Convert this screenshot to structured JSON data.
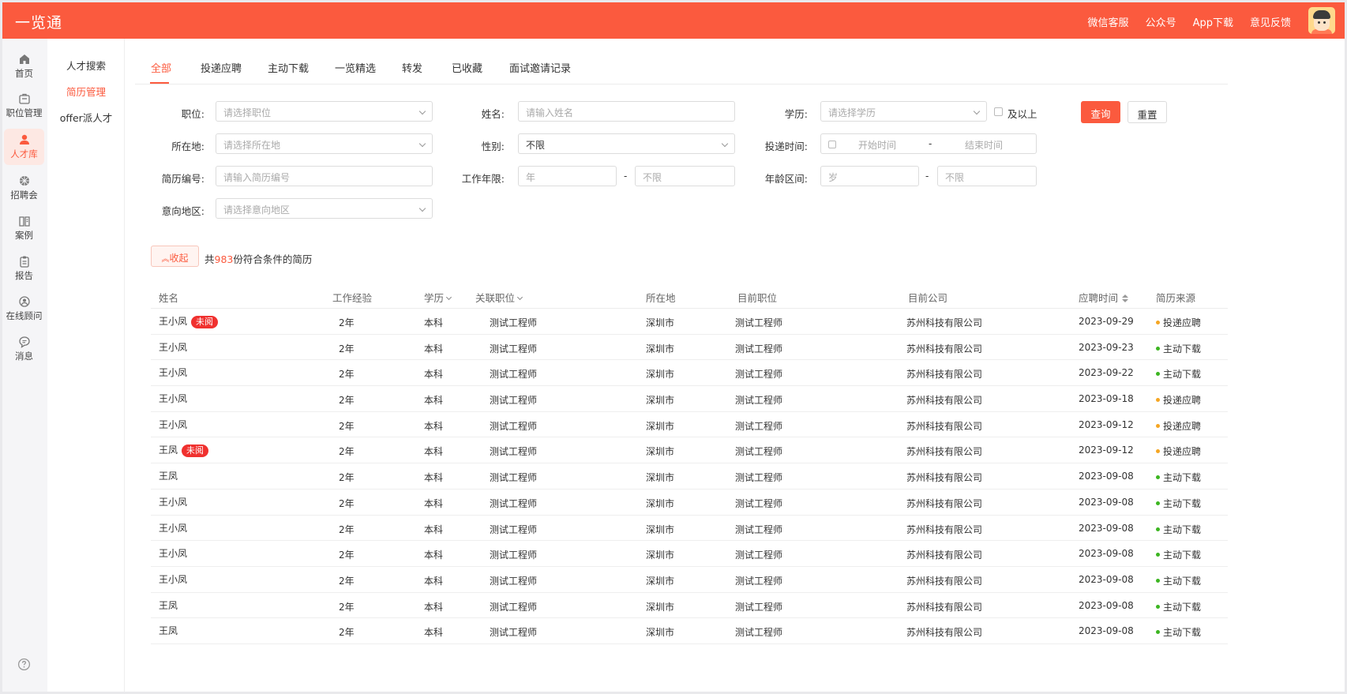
{
  "app": {
    "title": "一览通"
  },
  "top_links": [
    "微信客服",
    "公众号",
    "App下载",
    "意见反馈"
  ],
  "rail": [
    {
      "label": "首页",
      "icon": "home-icon",
      "active": false
    },
    {
      "label": "职位管理",
      "icon": "briefcase-icon",
      "active": false
    },
    {
      "label": "人才库",
      "icon": "person-icon",
      "active": true
    },
    {
      "label": "招聘会",
      "icon": "fair-icon",
      "active": false
    },
    {
      "label": "案例",
      "icon": "book-icon",
      "active": false
    },
    {
      "label": "报告",
      "icon": "clipboard-icon",
      "active": false
    },
    {
      "label": "在线顾问",
      "icon": "advisor-icon",
      "active": false
    },
    {
      "label": "消息",
      "icon": "message-icon",
      "active": false
    }
  ],
  "submenu": [
    {
      "label": "人才搜索",
      "active": false
    },
    {
      "label": "简历管理",
      "active": true
    },
    {
      "label": "offer派人才",
      "active": false
    }
  ],
  "tabs": [
    "全部",
    "投递应聘",
    "主动下载",
    "一览精选",
    "转发",
    "已收藏",
    "面试邀请记录"
  ],
  "filters": {
    "position": {
      "label": "职位:",
      "placeholder": "请选择职位"
    },
    "name": {
      "label": "姓名:",
      "placeholder": "请输入姓名"
    },
    "education": {
      "label": "学历:",
      "placeholder": "请选择学历",
      "above_label": "及以上"
    },
    "location": {
      "label": "所在地:",
      "placeholder": "请选择所在地"
    },
    "gender": {
      "label": "性别:",
      "value": "不限"
    },
    "apply_time": {
      "label": "投递时间:",
      "start": "开始时间",
      "end": "结束时间",
      "sep": "-"
    },
    "resume_no": {
      "label": "简历编号:",
      "placeholder": "请输入简历编号"
    },
    "work_years": {
      "label": "工作年限:",
      "from": "年",
      "to": "不限",
      "sep": "-"
    },
    "age_range": {
      "label": "年龄区间:",
      "from": "岁",
      "to": "不限",
      "sep": "-"
    },
    "intent_region": {
      "label": "意向地区:",
      "placeholder": "请选择意向地区"
    },
    "query_button": "查询",
    "reset_button": "重置"
  },
  "collapse_button": "收起",
  "summary": {
    "prefix": "共",
    "count": "983",
    "suffix": "份符合条件的简历"
  },
  "table": {
    "columns": [
      "姓名",
      "工作经验",
      "学历",
      "关联职位",
      "所在地",
      "目前职位",
      "目前公司",
      "应聘时间",
      "简历来源"
    ],
    "unread_label": "未阅",
    "source_colors": {
      "投递应聘": "#f5a623",
      "主动下载": "#3cb521"
    },
    "rows": [
      {
        "name": "王小凤",
        "unread": true,
        "exp": "2年",
        "edu": "本科",
        "job": "测试工程师",
        "city": "深圳市",
        "cur_job": "测试工程师",
        "company": "苏州科技有限公司",
        "date": "2023-09-29",
        "source": "投递应聘"
      },
      {
        "name": "王小凤",
        "unread": false,
        "exp": "2年",
        "edu": "本科",
        "job": "测试工程师",
        "city": "深圳市",
        "cur_job": "测试工程师",
        "company": "苏州科技有限公司",
        "date": "2023-09-23",
        "source": "主动下载"
      },
      {
        "name": "王小凤",
        "unread": false,
        "exp": "2年",
        "edu": "本科",
        "job": "测试工程师",
        "city": "深圳市",
        "cur_job": "测试工程师",
        "company": "苏州科技有限公司",
        "date": "2023-09-22",
        "source": "主动下载"
      },
      {
        "name": "王小凤",
        "unread": false,
        "exp": "2年",
        "edu": "本科",
        "job": "测试工程师",
        "city": "深圳市",
        "cur_job": "测试工程师",
        "company": "苏州科技有限公司",
        "date": "2023-09-18",
        "source": "投递应聘"
      },
      {
        "name": "王小凤",
        "unread": false,
        "exp": "2年",
        "edu": "本科",
        "job": "测试工程师",
        "city": "深圳市",
        "cur_job": "测试工程师",
        "company": "苏州科技有限公司",
        "date": "2023-09-12",
        "source": "投递应聘"
      },
      {
        "name": "王凤",
        "unread": true,
        "exp": "2年",
        "edu": "本科",
        "job": "测试工程师",
        "city": "深圳市",
        "cur_job": "测试工程师",
        "company": "苏州科技有限公司",
        "date": "2023-09-12",
        "source": "投递应聘"
      },
      {
        "name": "王凤",
        "unread": false,
        "exp": "2年",
        "edu": "本科",
        "job": "测试工程师",
        "city": "深圳市",
        "cur_job": "测试工程师",
        "company": "苏州科技有限公司",
        "date": "2023-09-08",
        "source": "主动下载"
      },
      {
        "name": "王小凤",
        "unread": false,
        "exp": "2年",
        "edu": "本科",
        "job": "测试工程师",
        "city": "深圳市",
        "cur_job": "测试工程师",
        "company": "苏州科技有限公司",
        "date": "2023-09-08",
        "source": "主动下载"
      },
      {
        "name": "王小凤",
        "unread": false,
        "exp": "2年",
        "edu": "本科",
        "job": "测试工程师",
        "city": "深圳市",
        "cur_job": "测试工程师",
        "company": "苏州科技有限公司",
        "date": "2023-09-08",
        "source": "主动下载"
      },
      {
        "name": "王小凤",
        "unread": false,
        "exp": "2年",
        "edu": "本科",
        "job": "测试工程师",
        "city": "深圳市",
        "cur_job": "测试工程师",
        "company": "苏州科技有限公司",
        "date": "2023-09-08",
        "source": "主动下载"
      },
      {
        "name": "王小凤",
        "unread": false,
        "exp": "2年",
        "edu": "本科",
        "job": "测试工程师",
        "city": "深圳市",
        "cur_job": "测试工程师",
        "company": "苏州科技有限公司",
        "date": "2023-09-08",
        "source": "主动下载"
      },
      {
        "name": "王凤",
        "unread": false,
        "exp": "2年",
        "edu": "本科",
        "job": "测试工程师",
        "city": "深圳市",
        "cur_job": "测试工程师",
        "company": "苏州科技有限公司",
        "date": "2023-09-08",
        "source": "主动下载"
      },
      {
        "name": "王凤",
        "unread": false,
        "exp": "2年",
        "edu": "本科",
        "job": "测试工程师",
        "city": "深圳市",
        "cur_job": "测试工程师",
        "company": "苏州科技有限公司",
        "date": "2023-09-08",
        "source": "主动下载"
      }
    ]
  },
  "colors": {
    "brand": "#fb5a3e",
    "unread_badge": "#f0312f"
  }
}
